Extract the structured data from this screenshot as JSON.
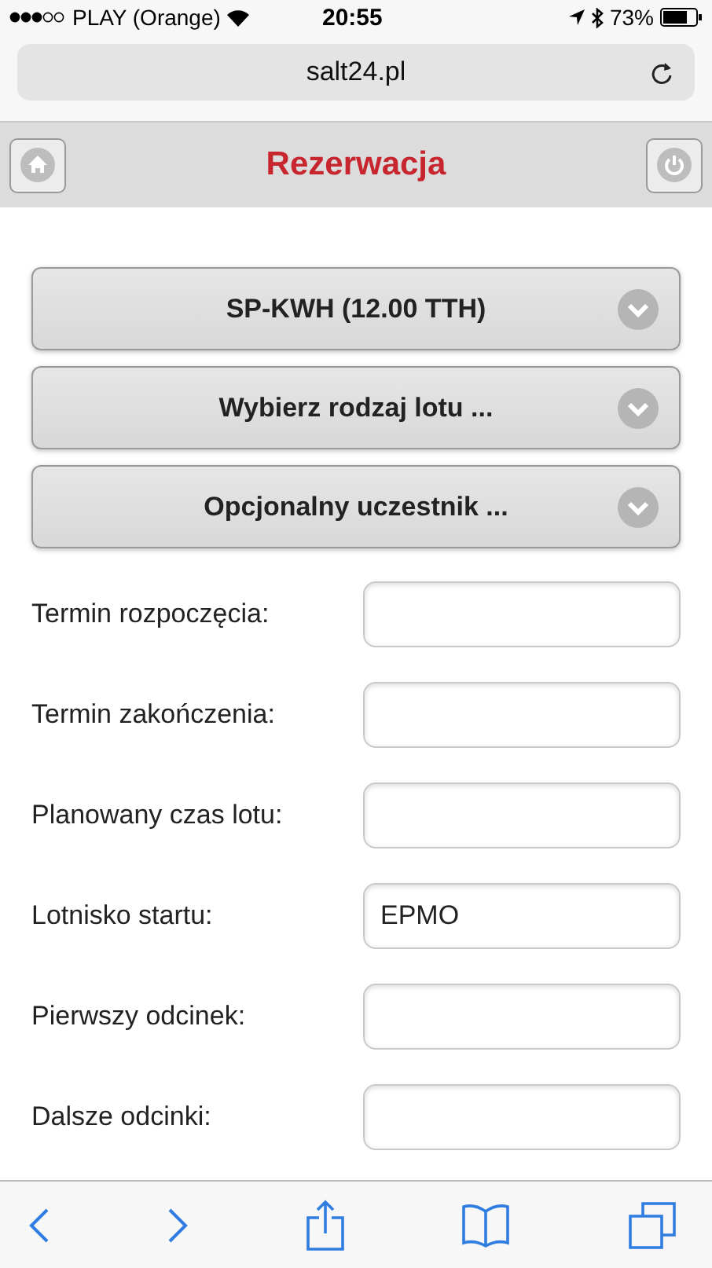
{
  "status_bar": {
    "carrier": "PLAY (Orange)",
    "time": "20:55",
    "battery": "73%"
  },
  "address_bar": {
    "url": "salt24.pl"
  },
  "header": {
    "title": "Rezerwacja"
  },
  "selects": [
    {
      "label": "SP-KWH (12.00 TTH)"
    },
    {
      "label": "Wybierz rodzaj lotu ..."
    },
    {
      "label": "Opcjonalny uczestnik ..."
    }
  ],
  "fields": [
    {
      "label": "Termin rozpoczęcia:"
    },
    {
      "label": "Termin zakończenia:"
    },
    {
      "label": "Planowany czas lotu:"
    },
    {
      "label": "Lotnisko startu:",
      "value": "EPMO"
    },
    {
      "label": "Pierwszy odcinek:"
    },
    {
      "label": "Dalsze odcinki:"
    }
  ]
}
